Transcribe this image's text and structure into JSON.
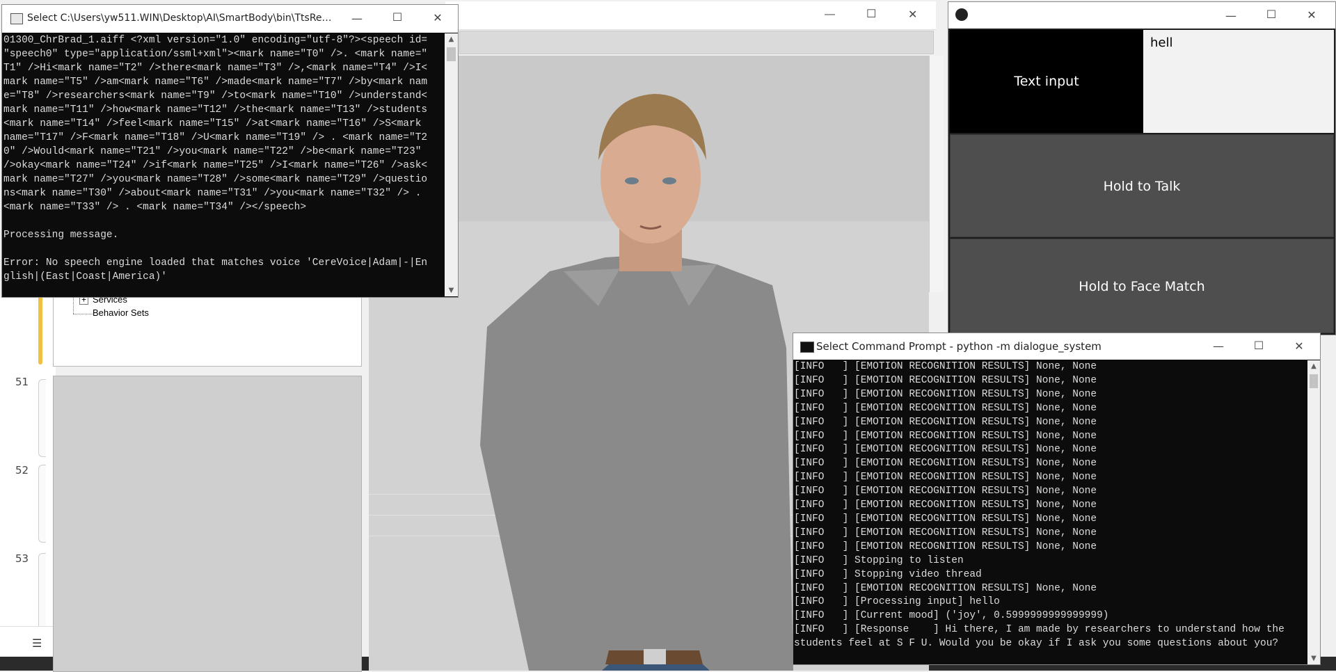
{
  "desktop": {
    "line_numbers": [
      "51",
      "52",
      "53"
    ]
  },
  "tts_console": {
    "title": "Select C:\\Users\\yw511.WIN\\Desktop\\AI\\SmartBody\\bin\\TtsRelay...",
    "lines": [
      "01300_ChrBrad_1.aiff <?xml version=\"1.0\" encoding=\"utf-8\"?><speech id=",
      "\"speech0\" type=\"application/ssml+xml\"><mark name=\"T0\" />. <mark name=\"",
      "T1\" />Hi<mark name=\"T2\" />there<mark name=\"T3\" />,<mark name=\"T4\" />I<",
      "mark name=\"T5\" />am<mark name=\"T6\" />made<mark name=\"T7\" />by<mark nam",
      "e=\"T8\" />researchers<mark name=\"T9\" />to<mark name=\"T10\" />understand<",
      "mark name=\"T11\" />how<mark name=\"T12\" />the<mark name=\"T13\" />students",
      "<mark name=\"T14\" />feel<mark name=\"T15\" />at<mark name=\"T16\" />S<mark",
      "name=\"T17\" />F<mark name=\"T18\" />U<mark name=\"T19\" /> . <mark name=\"T2",
      "0\" />Would<mark name=\"T21\" />you<mark name=\"T22\" />be<mark name=\"T23\"",
      "/>okay<mark name=\"T24\" />if<mark name=\"T25\" />I<mark name=\"T26\" />ask<",
      "mark name=\"T27\" />you<mark name=\"T28\" />some<mark name=\"T29\" />questio",
      "ns<mark name=\"T30\" />about<mark name=\"T31\" />you<mark name=\"T32\" /> .",
      "<mark name=\"T33\" /> . <mark name=\"T34\" /></speech>",
      "",
      "Processing message.",
      "",
      "Error: No speech engine loaded that matches voice 'CereVoice|Adam|-|En",
      "glish|(East|Coast|America)'"
    ]
  },
  "smartbody": {
    "tree_items": [
      "Services",
      "Behavior Sets"
    ],
    "tree_toggle": "+"
  },
  "controller": {
    "text_input_label": "Text input",
    "text_value": "hell",
    "hold_to_talk_label": "Hold to Talk",
    "hold_to_face_match_label": "Hold to Face Match"
  },
  "cmd_console": {
    "title": "Select Command Prompt - python  -m dialogue_system",
    "lines": [
      "[INFO   ] [EMOTION RECOGNITION RESULTS] None, None",
      "[INFO   ] [EMOTION RECOGNITION RESULTS] None, None",
      "[INFO   ] [EMOTION RECOGNITION RESULTS] None, None",
      "[INFO   ] [EMOTION RECOGNITION RESULTS] None, None",
      "[INFO   ] [EMOTION RECOGNITION RESULTS] None, None",
      "[INFO   ] [EMOTION RECOGNITION RESULTS] None, None",
      "[INFO   ] [EMOTION RECOGNITION RESULTS] None, None",
      "[INFO   ] [EMOTION RECOGNITION RESULTS] None, None",
      "[INFO   ] [EMOTION RECOGNITION RESULTS] None, None",
      "[INFO   ] [EMOTION RECOGNITION RESULTS] None, None",
      "[INFO   ] [EMOTION RECOGNITION RESULTS] None, None",
      "[INFO   ] [EMOTION RECOGNITION RESULTS] None, None",
      "[INFO   ] [EMOTION RECOGNITION RESULTS] None, None",
      "[INFO   ] [EMOTION RECOGNITION RESULTS] None, None",
      "[INFO   ] Stopping to listen",
      "[INFO   ] Stopping video thread",
      "[INFO   ] [EMOTION RECOGNITION RESULTS] None, None",
      "[INFO   ] [Processing input] hello",
      "[INFO   ] [Current mood] ('joy', 0.5999999999999999)",
      "[INFO   ] [Response    ] Hi there, I am made by researchers to understand how the",
      "students feel at S F U. Would you be okay if I ask you some questions about you?"
    ]
  },
  "colors": {
    "console_bg": "#0c0c0c",
    "console_fg": "#dcdcdc",
    "button_bg": "#4e4e4e",
    "panel_bg": "#000000",
    "accent": "#f0c040"
  },
  "window_controls": {
    "minimize": "—",
    "maximize": "☐",
    "close": "✕"
  }
}
